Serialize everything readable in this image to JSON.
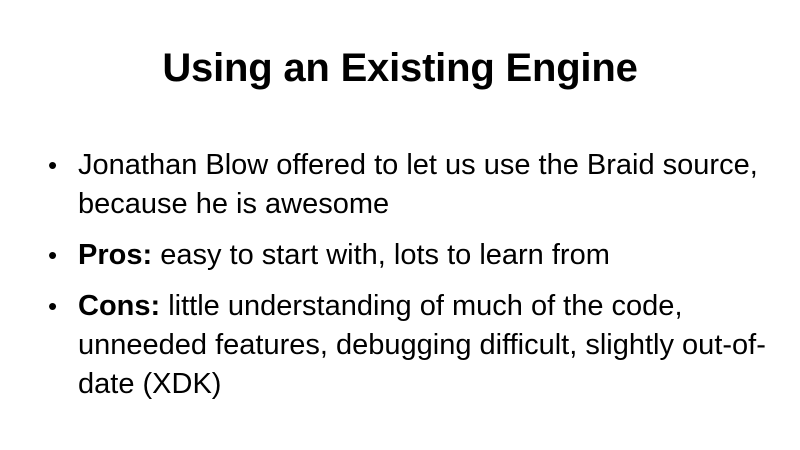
{
  "slide": {
    "title": "Using an Existing Engine",
    "bullet_marker": "•",
    "bullets": [
      {
        "lead": "",
        "text": "Jonathan Blow offered to let us use the Braid source, because he is awesome"
      },
      {
        "lead": "Pros:",
        "text": " easy to start with, lots to learn from"
      },
      {
        "lead": "Cons:",
        "text": " little understanding of much of the code, unneeded features, debugging difficult, slightly out-of-date (XDK)"
      }
    ]
  }
}
